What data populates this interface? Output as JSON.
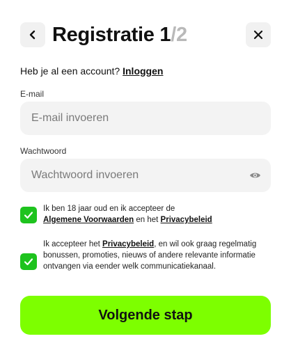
{
  "header": {
    "title": "Registratie",
    "step_current": "1",
    "step_separator": "/",
    "step_total": "2",
    "back_icon": "chevron-left-icon",
    "close_icon": "close-icon"
  },
  "login": {
    "prompt": "Heb je al een account?",
    "link": "Inloggen"
  },
  "email": {
    "label": "E-mail",
    "value": "",
    "placeholder": "E-mail invoeren"
  },
  "password": {
    "label": "Wachtwoord",
    "value": "",
    "placeholder": "Wachtwoord invoeren",
    "toggle_icon": "eye-icon"
  },
  "consent_terms": {
    "checked": true,
    "text_before": "Ik ben 18 jaar oud en ik accepteer de",
    "link_terms": "Algemene Voorwaarden",
    "text_middle": "en het",
    "link_privacy": "Privacybeleid"
  },
  "consent_marketing": {
    "checked": true,
    "text_before": "Ik accepteer het",
    "link_privacy": "Privacybeleid",
    "text_after": ", en wil ook graag regelmatig bonussen, promoties, nieuws of andere relevante informatie ontvangen via eender welk communicatiekanaal."
  },
  "cta": {
    "label": "Volgende stap"
  },
  "colors": {
    "accent": "#7dff00",
    "checkbox": "#1ec31e",
    "field_bg": "#f3f3f3",
    "step_total": "#b9b9b9"
  }
}
